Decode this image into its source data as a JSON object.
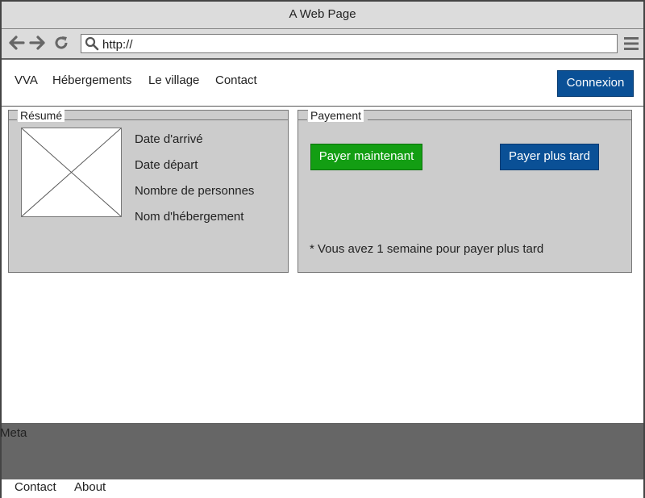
{
  "browser": {
    "title": "A Web Page",
    "url": "http://",
    "icons": [
      "back-arrow-icon",
      "forward-arrow-icon",
      "reload-icon",
      "search-icon",
      "hamburger-menu-icon"
    ]
  },
  "nav": {
    "brand": "VVA",
    "items": [
      {
        "label": "Hébergements"
      },
      {
        "label": "Le village"
      },
      {
        "label": "Contact"
      }
    ],
    "login_label": "Connexion"
  },
  "summary": {
    "legend": "Résumé",
    "lines": [
      "Date d'arrivé",
      "Date départ",
      "Nombre de personnes",
      "Nom d'hébergement"
    ]
  },
  "payment": {
    "legend": "Payement",
    "pay_now_label": "Payer maintenant",
    "pay_later_label": "Payer plus tard",
    "note": "* Vous avez 1 semaine pour payer plus tard"
  },
  "meta": {
    "label": "Meta"
  },
  "footer": {
    "links": [
      {
        "label": "Contact"
      },
      {
        "label": "About"
      }
    ]
  },
  "colors": {
    "primary_blue": "#0a5096",
    "green": "#139e13",
    "panel_gray": "#cccccc",
    "meta_gray": "#666666",
    "chrome_gray": "#dcdcdc"
  }
}
